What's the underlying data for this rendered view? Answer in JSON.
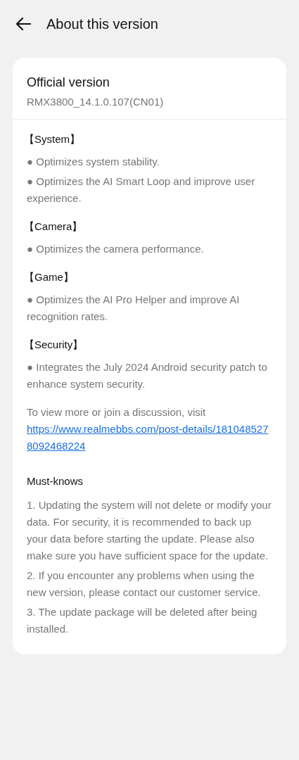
{
  "header": {
    "title": "About this version"
  },
  "card": {
    "title": "Official version",
    "version": "RMX3800_14.1.0.107(CN01)",
    "sections": [
      {
        "heading": "【System】",
        "items": [
          "● Optimizes system stability.",
          "● Optimizes the AI Smart Loop and improve user experience."
        ]
      },
      {
        "heading": "【Camera】",
        "items": [
          "● Optimizes the camera performance."
        ]
      },
      {
        "heading": "【Game】",
        "items": [
          "● Optimizes the AI Pro Helper and improve AI recognition rates."
        ]
      },
      {
        "heading": "【Security】",
        "items": [
          "● Integrates the July 2024 Android security patch to enhance system security."
        ]
      }
    ],
    "visit_text": "To view more or join a discussion, visit",
    "link": "https://www.realmebbs.com/post-details/1810485278092468224",
    "must_knows": {
      "heading": "Must-knows",
      "items": [
        "1. Updating the system will not delete or modify your data. For security, it is recommended to back up your data before starting the update. Please also make sure you have sufficient space for the update.",
        "2. If you encounter any problems when using the new version, please contact our customer service.",
        "3. The update package will be deleted after being installed."
      ]
    }
  }
}
